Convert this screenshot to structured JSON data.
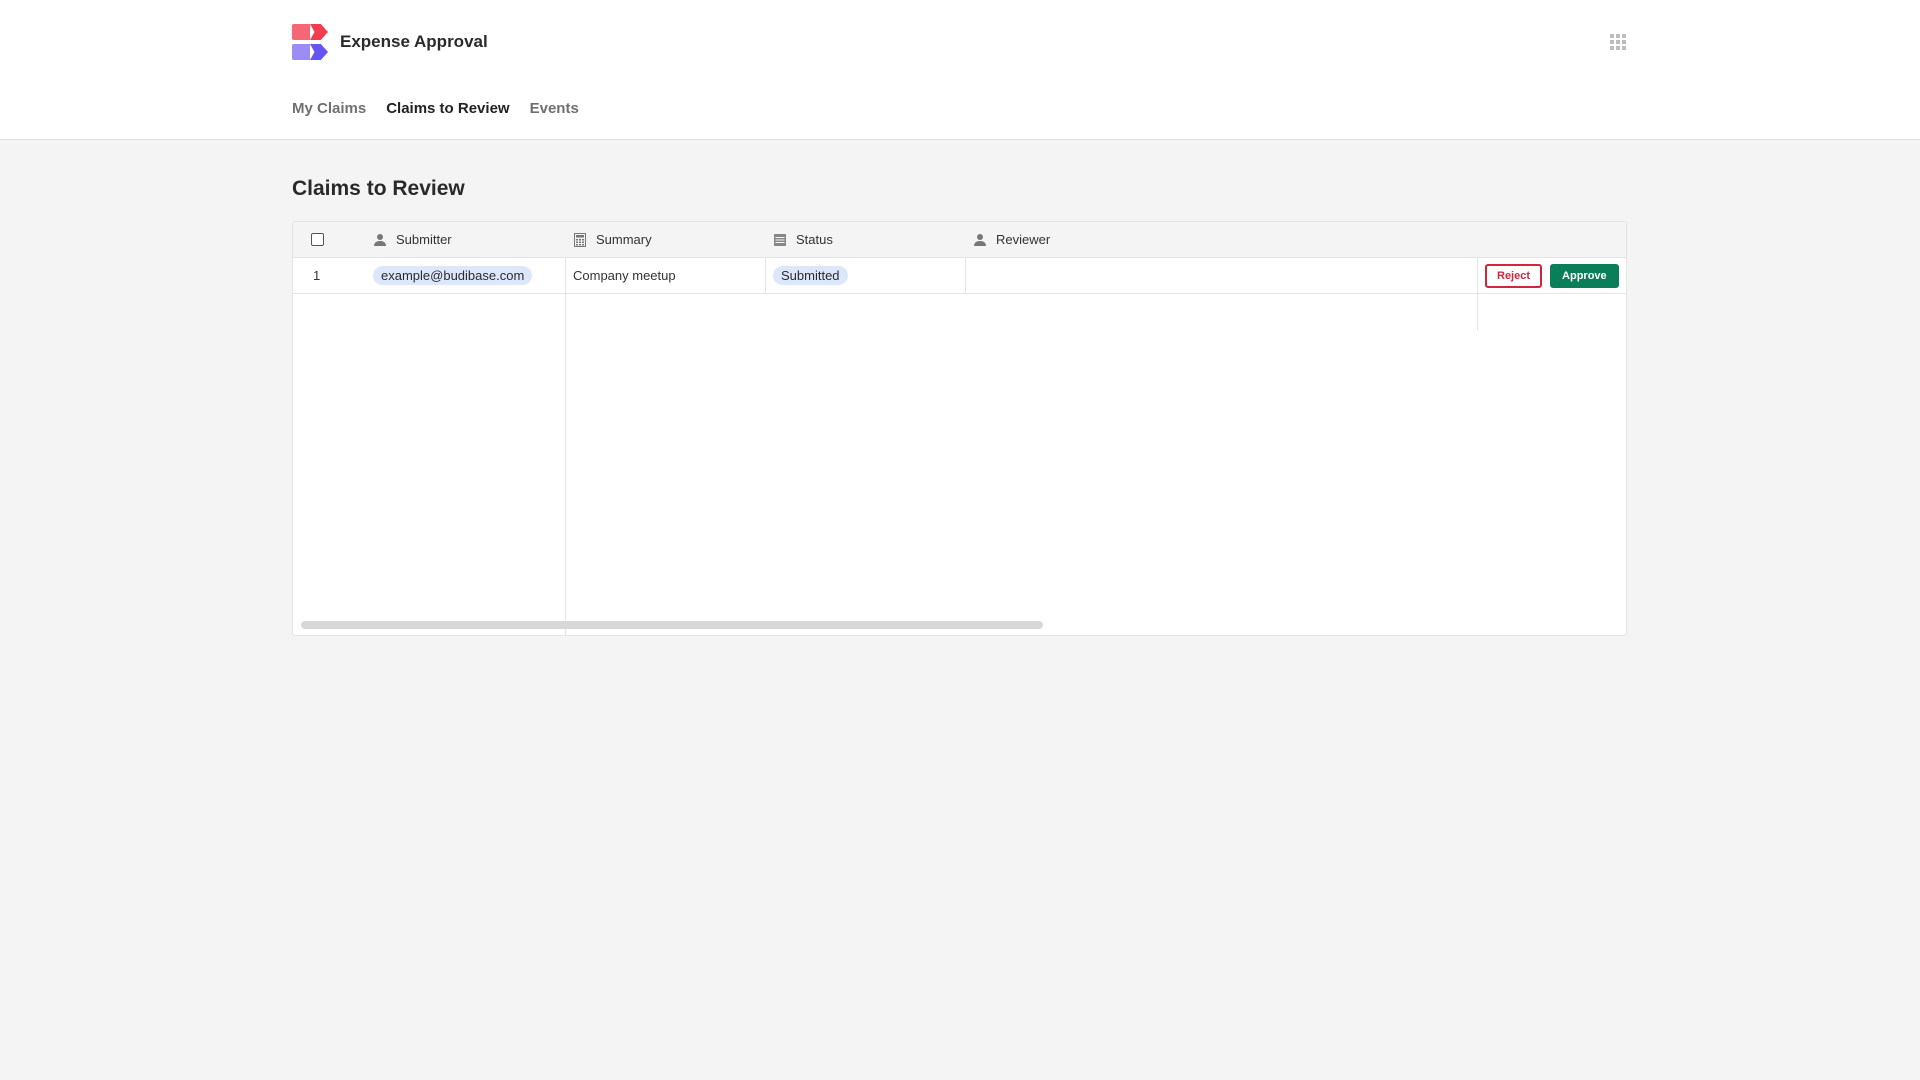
{
  "app": {
    "title": "Expense Approval",
    "logo": "budibase-logo",
    "apps_menu_icon": "grid-dots-icon"
  },
  "nav": {
    "items": [
      {
        "label": "My Claims",
        "active": false
      },
      {
        "label": "Claims to Review",
        "active": true
      },
      {
        "label": "Events",
        "active": false
      }
    ]
  },
  "page": {
    "title": "Claims to Review"
  },
  "table": {
    "columns": [
      {
        "label": "Submitter",
        "icon": "user-icon"
      },
      {
        "label": "Summary",
        "icon": "calculator-icon"
      },
      {
        "label": "Status",
        "icon": "list-icon"
      },
      {
        "label": "Reviewer",
        "icon": "user-icon"
      }
    ],
    "rows": [
      {
        "index": "1",
        "submitter": "example@budibase.com",
        "summary": "Company meetup",
        "status": "Submitted",
        "reviewer": "",
        "actions": {
          "reject": "Reject",
          "approve": "Approve"
        }
      }
    ]
  },
  "colors": {
    "reject": "#d3253c",
    "approve": "#097e59",
    "pill": "#dde7fb"
  }
}
